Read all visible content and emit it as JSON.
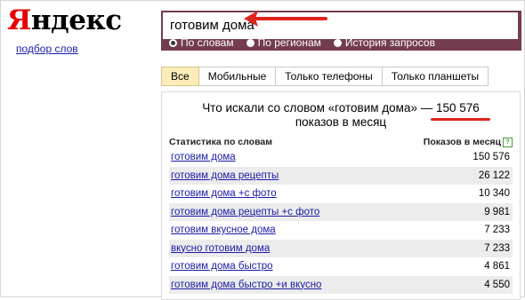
{
  "logo": {
    "first": "Я",
    "rest": "ндекс"
  },
  "wordstat_link": "подбор слов",
  "search": {
    "value": "готовим дома"
  },
  "radios": [
    {
      "label": "По словам",
      "selected": true
    },
    {
      "label": "По регионам",
      "selected": false
    },
    {
      "label": "История запросов",
      "selected": false
    }
  ],
  "tabs": [
    {
      "label": "Все",
      "active": true
    },
    {
      "label": "Мобильные",
      "active": false
    },
    {
      "label": "Только телефоны",
      "active": false
    },
    {
      "label": "Только планшеты",
      "active": false
    }
  ],
  "headline": {
    "line1_prefix": "Что искали со словом «готовим дома» —",
    "count": "150 576",
    "line2": "показов в месяц"
  },
  "table": {
    "header_left": "Статистика по словам",
    "header_right": "Показов в месяц",
    "help_icon": "?",
    "rows": [
      {
        "phrase": "готовим дома",
        "count": "150 576"
      },
      {
        "phrase": "готовим дома рецепты",
        "count": "26 122"
      },
      {
        "phrase": "готовим дома +с фото",
        "count": "10 340"
      },
      {
        "phrase": "готовим дома рецепты +с фото",
        "count": "9 981"
      },
      {
        "phrase": "готовим вкусное дома",
        "count": "7 233"
      },
      {
        "phrase": "вкусно готовим дома",
        "count": "7 233"
      },
      {
        "phrase": "готовим дома быстро",
        "count": "4 861"
      },
      {
        "phrase": "готовим дома быстро +и вкусно",
        "count": "4 550"
      }
    ]
  },
  "colors": {
    "accent": "#e60000",
    "search_bg": "#733c4f",
    "link": "#1a1aa6",
    "active_tab": "#fbecb8",
    "annotation": "#e0241d"
  }
}
